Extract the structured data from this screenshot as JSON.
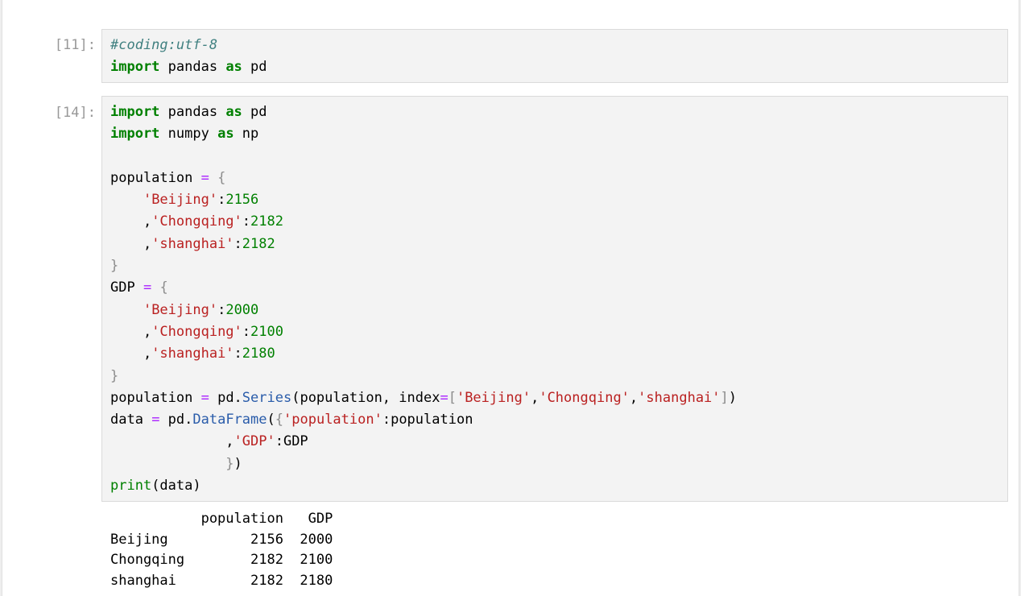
{
  "cells": [
    {
      "prompt": "[11]:",
      "lines": [
        [
          {
            "t": "#coding:utf-8",
            "c": "cm"
          }
        ],
        [
          {
            "t": "import",
            "c": "kw"
          },
          {
            "t": " pandas "
          },
          {
            "t": "as",
            "c": "kw"
          },
          {
            "t": " pd"
          }
        ]
      ]
    },
    {
      "prompt": "[14]:",
      "lines": [
        [
          {
            "t": "import",
            "c": "kw"
          },
          {
            "t": " pandas "
          },
          {
            "t": "as",
            "c": "kw"
          },
          {
            "t": " pd"
          }
        ],
        [
          {
            "t": "import",
            "c": "kw"
          },
          {
            "t": " numpy "
          },
          {
            "t": "as",
            "c": "kw"
          },
          {
            "t": " np"
          }
        ],
        [],
        [
          {
            "t": "population "
          },
          {
            "t": "=",
            "c": "op"
          },
          {
            "t": " "
          },
          {
            "t": "{",
            "c": "pn"
          }
        ],
        [
          {
            "t": "    "
          },
          {
            "t": "'Beijing'",
            "c": "str"
          },
          {
            "t": ":"
          },
          {
            "t": "2156",
            "c": "num"
          }
        ],
        [
          {
            "t": "    ,"
          },
          {
            "t": "'Chongqing'",
            "c": "str"
          },
          {
            "t": ":"
          },
          {
            "t": "2182",
            "c": "num"
          }
        ],
        [
          {
            "t": "    ,"
          },
          {
            "t": "'shanghai'",
            "c": "str"
          },
          {
            "t": ":"
          },
          {
            "t": "2182",
            "c": "num"
          }
        ],
        [
          {
            "t": "}",
            "c": "pn"
          }
        ],
        [
          {
            "t": "GDP "
          },
          {
            "t": "=",
            "c": "op"
          },
          {
            "t": " "
          },
          {
            "t": "{",
            "c": "pn"
          }
        ],
        [
          {
            "t": "    "
          },
          {
            "t": "'Beijing'",
            "c": "str"
          },
          {
            "t": ":"
          },
          {
            "t": "2000",
            "c": "num"
          }
        ],
        [
          {
            "t": "    ,"
          },
          {
            "t": "'Chongqing'",
            "c": "str"
          },
          {
            "t": ":"
          },
          {
            "t": "2100",
            "c": "num"
          }
        ],
        [
          {
            "t": "    ,"
          },
          {
            "t": "'shanghai'",
            "c": "str"
          },
          {
            "t": ":"
          },
          {
            "t": "2180",
            "c": "num"
          }
        ],
        [
          {
            "t": "}",
            "c": "pn"
          }
        ],
        [
          {
            "t": "population "
          },
          {
            "t": "=",
            "c": "op"
          },
          {
            "t": " pd."
          },
          {
            "t": "Series",
            "c": "attr"
          },
          {
            "t": "(population, index"
          },
          {
            "t": "=",
            "c": "op"
          },
          {
            "t": "[",
            "c": "pn"
          },
          {
            "t": "'Beijing'",
            "c": "str"
          },
          {
            "t": ","
          },
          {
            "t": "'Chongqing'",
            "c": "str"
          },
          {
            "t": ","
          },
          {
            "t": "'shanghai'",
            "c": "str"
          },
          {
            "t": "]",
            "c": "pn"
          },
          {
            "t": ")"
          }
        ],
        [
          {
            "t": "data "
          },
          {
            "t": "=",
            "c": "op"
          },
          {
            "t": " pd."
          },
          {
            "t": "DataFrame",
            "c": "attr"
          },
          {
            "t": "("
          },
          {
            "t": "{",
            "c": "pn"
          },
          {
            "t": "'population'",
            "c": "str"
          },
          {
            "t": ":population"
          }
        ],
        [
          {
            "t": "              ,"
          },
          {
            "t": "'GDP'",
            "c": "str"
          },
          {
            "t": ":GDP"
          }
        ],
        [
          {
            "t": "              "
          },
          {
            "t": "}",
            "c": "pn"
          },
          {
            "t": ")"
          }
        ],
        [
          {
            "t": "print",
            "c": "bi"
          },
          {
            "t": "(data)"
          }
        ]
      ],
      "output": "           population   GDP\nBeijing          2156  2000\nChongqing        2182  2100\nshanghai         2182  2180"
    }
  ]
}
